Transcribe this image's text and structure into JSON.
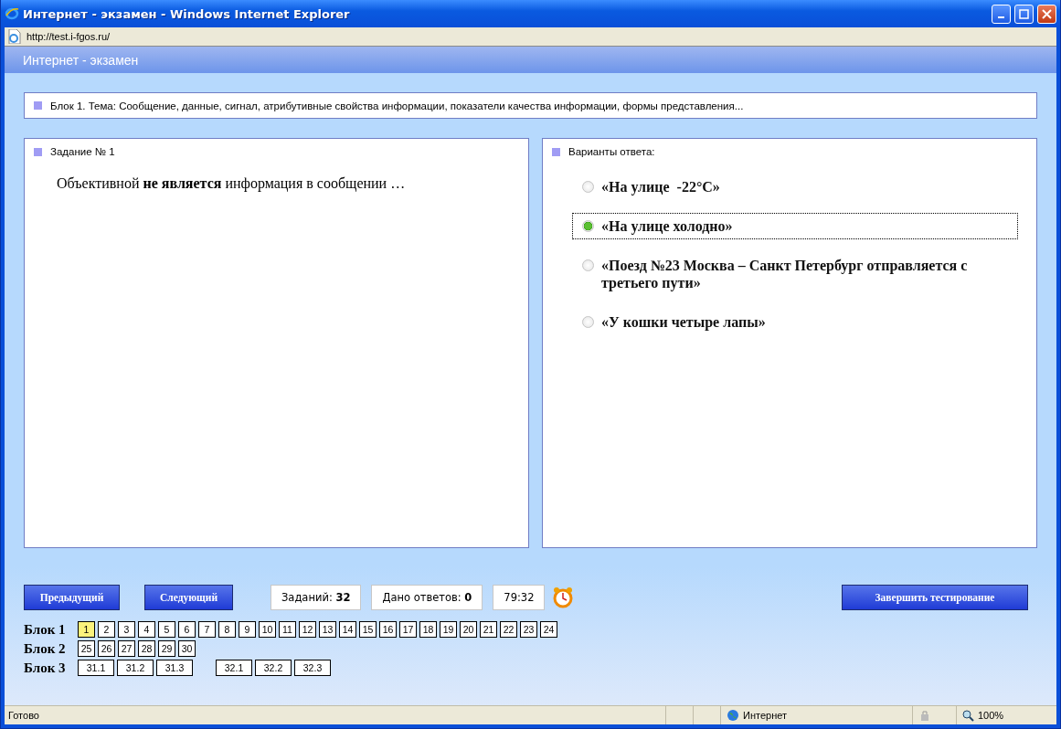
{
  "window": {
    "title": "Интернет - экзамен - Windows Internet Explorer"
  },
  "address": "http://test.i-fgos.ru/",
  "app_title": "Интернет - экзамен",
  "topic": "Блок 1. Тема: Сообщение, данные, сигнал, атрибутивные свойства информации, показатели качества информации, формы представления...",
  "task": {
    "label": "Задание № 1",
    "question": "Объективной **не является** информация в сообщении …"
  },
  "answers": {
    "label": "Варианты ответа:",
    "options": [
      {
        "text": "«На улице  -22°С»",
        "selected": false
      },
      {
        "text": "«На улице холодно»",
        "selected": true
      },
      {
        "text": "«Поезд №23 Москва – Санкт Петербург отправляется с третьего пути»",
        "selected": false
      },
      {
        "text": "«У кошки четыре лапы»",
        "selected": false
      }
    ]
  },
  "nav": {
    "prev": "Предыдущий",
    "next": "Следующий",
    "counters": [
      "Заданий: **32**",
      "Дано ответов: **0**"
    ],
    "timer": "79:32",
    "finish": "Завершить тестирование"
  },
  "blocks": [
    {
      "label": "Блок 1",
      "groups": [
        [
          {
            "label": "1",
            "selected": true
          },
          {
            "label": "2",
            "selected": false
          },
          {
            "label": "3",
            "selected": false
          },
          {
            "label": "4",
            "selected": false
          },
          {
            "label": "5",
            "selected": false
          },
          {
            "label": "6",
            "selected": false
          },
          {
            "label": "7",
            "selected": false
          },
          {
            "label": "8",
            "selected": false
          },
          {
            "label": "9",
            "selected": false
          },
          {
            "label": "10",
            "selected": false
          },
          {
            "label": "11",
            "selected": false
          },
          {
            "label": "12",
            "selected": false
          },
          {
            "label": "13",
            "selected": false
          },
          {
            "label": "14",
            "selected": false
          },
          {
            "label": "15",
            "selected": false
          },
          {
            "label": "16",
            "selected": false
          },
          {
            "label": "17",
            "selected": false
          },
          {
            "label": "18",
            "selected": false
          },
          {
            "label": "19",
            "selected": false
          },
          {
            "label": "20",
            "selected": false
          },
          {
            "label": "21",
            "selected": false
          },
          {
            "label": "22",
            "selected": false
          },
          {
            "label": "23",
            "selected": false
          },
          {
            "label": "24",
            "selected": false
          }
        ]
      ]
    },
    {
      "label": "Блок 2",
      "groups": [
        [
          {
            "label": "25",
            "selected": false
          },
          {
            "label": "26",
            "selected": false
          },
          {
            "label": "27",
            "selected": false
          },
          {
            "label": "28",
            "selected": false
          },
          {
            "label": "29",
            "selected": false
          },
          {
            "label": "30",
            "selected": false
          }
        ]
      ]
    },
    {
      "label": "Блок 3",
      "groups": [
        [
          {
            "label": "31.1",
            "selected": false
          },
          {
            "label": "31.2",
            "selected": false
          },
          {
            "label": "31.3",
            "selected": false
          }
        ],
        [
          {
            "label": "32.1",
            "selected": false
          },
          {
            "label": "32.2",
            "selected": false
          },
          {
            "label": "32.3",
            "selected": false
          }
        ]
      ]
    }
  ],
  "status_bar": {
    "text": "Готово",
    "zone": "Интернет",
    "zoom": "100%"
  }
}
